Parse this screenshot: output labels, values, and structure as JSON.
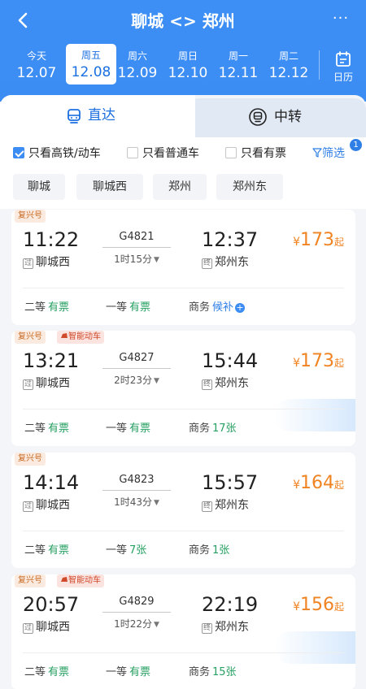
{
  "header": {
    "title": "聊城 <> 郑州",
    "back_icon": "chevron-left-icon",
    "more_icon": "more-dots-icon",
    "more_text": "···",
    "dates": [
      {
        "weekday": "今天",
        "date": "12.07"
      },
      {
        "weekday": "周五",
        "date": "12.08",
        "selected": true
      },
      {
        "weekday": "周六",
        "date": "12.09"
      },
      {
        "weekday": "周日",
        "date": "12.10"
      },
      {
        "weekday": "周一",
        "date": "12.11"
      },
      {
        "weekday": "周二",
        "date": "12.12"
      }
    ],
    "calendar_label": "日历"
  },
  "tabs": [
    {
      "label": "直达",
      "icon": "train-icon",
      "active": true
    },
    {
      "label": "中转",
      "icon": "transfer-train-icon",
      "active": false
    }
  ],
  "filters": {
    "high_speed": {
      "label": "只看高铁/动车",
      "checked": true
    },
    "normal": {
      "label": "只看普通车",
      "checked": false
    },
    "available": {
      "label": "只看有票",
      "checked": false
    },
    "filter_label": "筛选",
    "filter_badge": "1"
  },
  "stations": [
    "聊城",
    "聊城西",
    "郑州",
    "郑州东"
  ],
  "trains": [
    {
      "tags": [
        "复兴号"
      ],
      "dep_time": "11:22",
      "arr_time": "12:37",
      "train_no": "G4821",
      "duration": "1时15分",
      "from_mark": "过",
      "from": "聊城西",
      "to_mark": "终",
      "to": "郑州东",
      "price": "173",
      "price_suffix": "起",
      "yen": "¥",
      "seats": [
        {
          "class": "二等",
          "status": "有票"
        },
        {
          "class": "一等",
          "status": "有票"
        },
        {
          "class": "商务",
          "status": "候补"
        }
      ]
    },
    {
      "tags": [
        "复兴号",
        "智能动车"
      ],
      "dep_time": "13:21",
      "arr_time": "15:44",
      "train_no": "G4827",
      "duration": "2时23分",
      "from_mark": "过",
      "from": "聊城西",
      "to_mark": "终",
      "to": "郑州东",
      "price": "173",
      "price_suffix": "起",
      "yen": "¥",
      "seats": [
        {
          "class": "二等",
          "status": "有票"
        },
        {
          "class": "一等",
          "status": "有票"
        },
        {
          "class": "商务",
          "status": "17张"
        }
      ]
    },
    {
      "tags": [
        "复兴号"
      ],
      "dep_time": "14:14",
      "arr_time": "15:57",
      "train_no": "G4823",
      "duration": "1时43分",
      "from_mark": "过",
      "from": "聊城西",
      "to_mark": "终",
      "to": "郑州东",
      "price": "164",
      "price_suffix": "起",
      "yen": "¥",
      "seats": [
        {
          "class": "二等",
          "status": "有票"
        },
        {
          "class": "一等",
          "status": "7张"
        },
        {
          "class": "商务",
          "status": "1张"
        }
      ]
    },
    {
      "tags": [
        "复兴号",
        "智能动车"
      ],
      "dep_time": "20:57",
      "arr_time": "22:19",
      "train_no": "G4829",
      "duration": "1时22分",
      "from_mark": "过",
      "from": "聊城西",
      "to_mark": "终",
      "to": "郑州东",
      "price": "156",
      "price_suffix": "起",
      "yen": "¥",
      "seats": [
        {
          "class": "二等",
          "status": "有票"
        },
        {
          "class": "一等",
          "status": "有票"
        },
        {
          "class": "商务",
          "status": "15张"
        }
      ]
    }
  ],
  "colors": {
    "header_blue": "#3b8cf3",
    "price_orange": "#f08322",
    "available_green": "#27a062",
    "link_blue": "#2f7fe6"
  }
}
